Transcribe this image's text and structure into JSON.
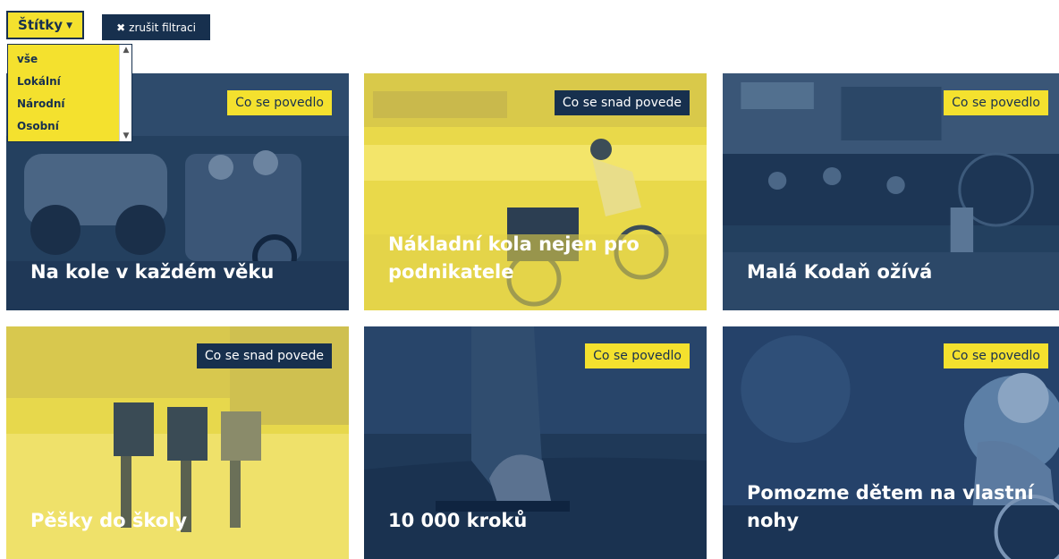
{
  "filter": {
    "label": "Štítky",
    "clear_label": "zrušit filtraci",
    "options": [
      "vše",
      "Lokální",
      "Národní",
      "Osobní"
    ]
  },
  "cards": [
    {
      "title": "Na kole v každém věku",
      "tag": "Co se povedlo"
    },
    {
      "title": "Nákladní kola nejen pro podnikatele",
      "tag": "Co se snad povede"
    },
    {
      "title": "Malá Kodaň ožívá",
      "tag": "Co se povedlo"
    },
    {
      "title": "Pěšky do školy",
      "tag": "Co se snad povede"
    },
    {
      "title": "10 000 kroků",
      "tag": "Co se povedlo"
    },
    {
      "title": "Pomozme dětem na vlastní nohy",
      "tag": "Co se povedlo"
    }
  ],
  "colors": {
    "navy": "#17304e",
    "yellow": "#f4e12e"
  }
}
